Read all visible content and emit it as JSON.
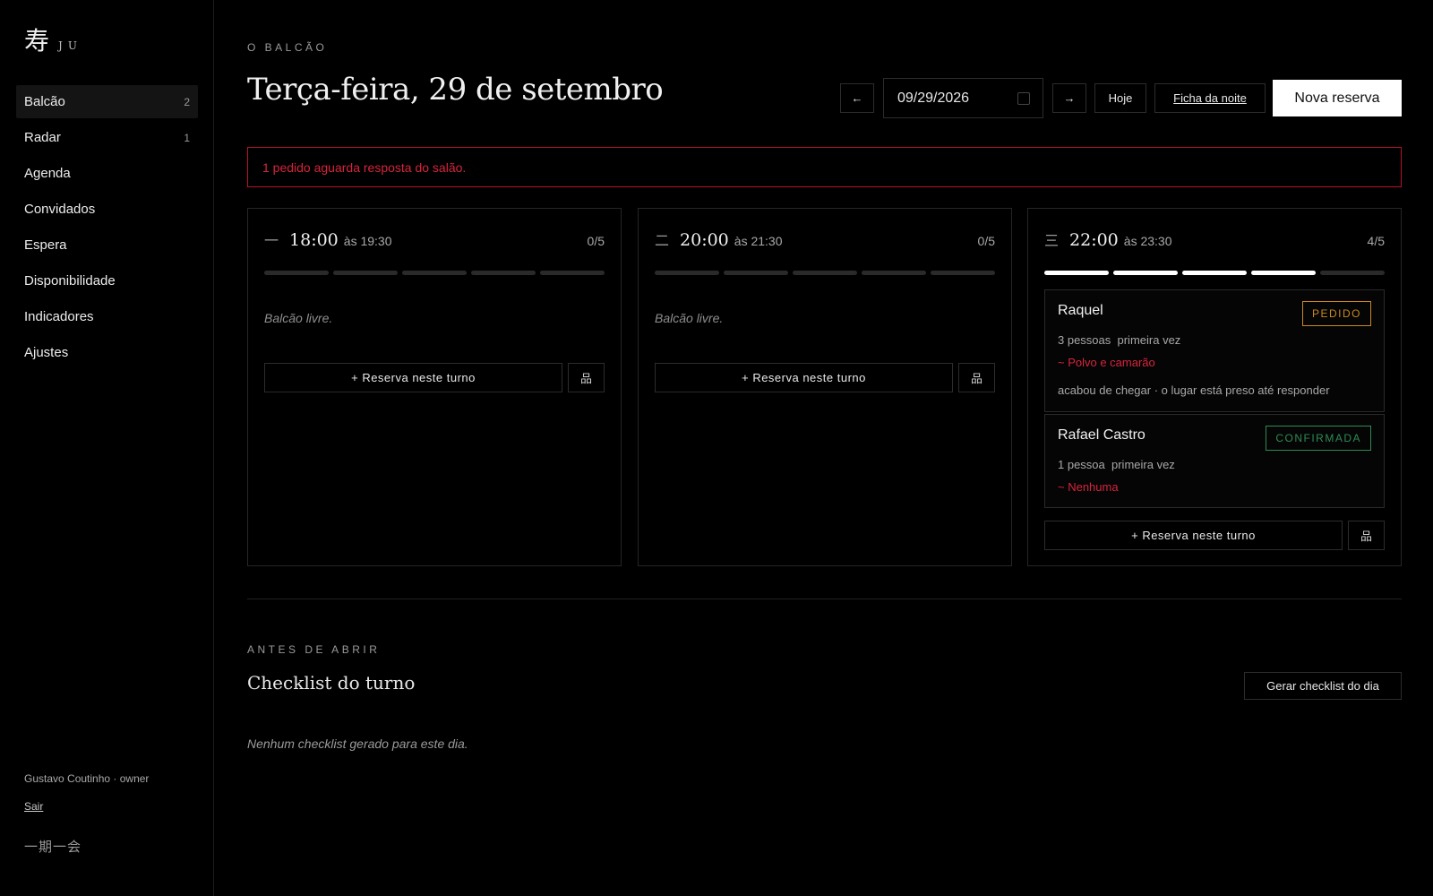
{
  "brand": {
    "glyph": "寿",
    "name": "JU"
  },
  "nav": [
    {
      "label": "Balcão",
      "count": "2",
      "active": true
    },
    {
      "label": "Radar",
      "count": "1"
    },
    {
      "label": "Agenda"
    },
    {
      "label": "Convidados"
    },
    {
      "label": "Espera"
    },
    {
      "label": "Disponibilidade"
    },
    {
      "label": "Indicadores"
    },
    {
      "label": "Ajustes"
    }
  ],
  "user": {
    "line": "Gustavo Coutinho · owner",
    "logout": "Sair"
  },
  "motto": "一期一会",
  "header": {
    "eyebrow": "O BALCÃO",
    "title": "Terça-feira, 29 de setembro",
    "date_value": "09/29/2026",
    "prev_icon": "arrow-left-icon",
    "next_icon": "arrow-right-icon",
    "today_label": "Hoje",
    "night_sheet_label": "Ficha da noite",
    "new_reservation_label": "Nova reserva"
  },
  "alert": {
    "text": "1 pedido aguarda resposta do salão.",
    "color": "#b8102a"
  },
  "turns": [
    {
      "num": "一",
      "time": "18:00",
      "until": "às 19:30",
      "capacity": "0/5",
      "filled": 0,
      "total": 5,
      "empty_text": "Balcão livre.",
      "add_label": "+ Reserva neste turno",
      "seat_icon": "seating-chart-icon"
    },
    {
      "num": "二",
      "time": "20:00",
      "until": "às 21:30",
      "capacity": "0/5",
      "filled": 0,
      "total": 5,
      "empty_text": "Balcão livre.",
      "add_label": "+ Reserva neste turno",
      "seat_icon": "seating-chart-icon"
    },
    {
      "num": "三",
      "time": "22:00",
      "until": "às 23:30",
      "capacity": "4/5",
      "filled": 4,
      "total": 5,
      "add_label": "+ Reserva neste turno",
      "seat_icon": "seating-chart-icon",
      "reservations": [
        {
          "name": "Raquel",
          "people": "3 pessoas",
          "tag": "primeira vez",
          "preference": "~ Polvo e camarão",
          "note": "acabou de chegar · o lugar está preso até responder",
          "status": "PEDIDO",
          "status_color": "#c8871f"
        },
        {
          "name": "Rafael Castro",
          "people": "1 pessoa",
          "tag": "primeira vez",
          "preference": "~ Nenhuma",
          "status": "CONFIRMADA",
          "status_color": "#2f8a55"
        }
      ]
    }
  ],
  "checklist": {
    "eyebrow": "ANTES DE ABRIR",
    "title": "Checklist do turno",
    "generate_label": "Gerar checklist do dia",
    "empty_text": "Nenhum checklist gerado para este dia."
  },
  "colors": {
    "accent_red": "#d6243c",
    "pending": "#c8871f",
    "confirmed": "#2f8a55"
  }
}
